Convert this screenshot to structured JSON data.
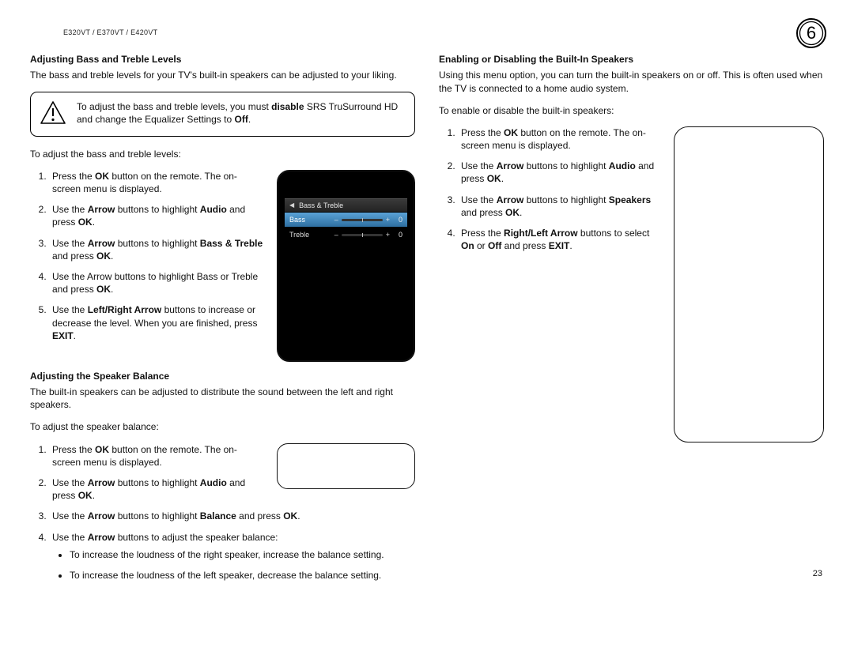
{
  "header": {
    "models": "E320VT / E370VT / E420VT",
    "chapter_number": "6"
  },
  "page_number": "23",
  "left": {
    "sec1": {
      "title": "Adjusting Bass and Treble Levels",
      "intro": "The bass and treble levels for your TV's built-in speakers can be adjusted to your liking.",
      "note_a": "To adjust the bass and treble levels, you must ",
      "note_b_bold": "disable",
      "note_c": " SRS TruSurround HD and change the Equalizer Settings to ",
      "note_d_bold": "Off",
      "note_e": ".",
      "lead": "To adjust the bass and treble levels:",
      "steps": {
        "s1a": "Press the ",
        "s1b": "OK",
        "s1c": " button on the remote. The on-screen menu is displayed.",
        "s2a": "Use the ",
        "s2b": "Arrow",
        "s2c": " buttons to highlight ",
        "s2d": "Audio",
        "s2e": " and press ",
        "s2f": "OK",
        "s2g": ".",
        "s3a": "Use the ",
        "s3b": "Arrow",
        "s3c": " buttons to highlight ",
        "s3d": "Bass & Treble",
        "s3e": " and press ",
        "s3f": "OK",
        "s3g": ".",
        "s4a": "Use the Arrow buttons to highlight Bass or Treble and press ",
        "s4b": "OK",
        "s4c": ".",
        "s5a": "Use the ",
        "s5b": "Left/Right Arrow",
        "s5c": " buttons to increase or decrease the level. When you are finished, press ",
        "s5d": "EXIT",
        "s5e": "."
      },
      "device_menu": {
        "title": "Bass & Treble",
        "rows": [
          {
            "label": "Bass",
            "value": "0",
            "selected": true
          },
          {
            "label": "Treble",
            "value": "0",
            "selected": false
          }
        ]
      }
    },
    "sec2": {
      "title": "Adjusting the Speaker Balance",
      "intro": "The built-in speakers can be adjusted to distribute the sound between the left and right speakers.",
      "lead": "To adjust the speaker balance:",
      "steps": {
        "s1a": "Press the ",
        "s1b": "OK",
        "s1c": " button on the remote. The on-screen menu is displayed.",
        "s2a": "Use the ",
        "s2b": "Arrow",
        "s2c": " buttons to highlight ",
        "s2d": "Audio",
        "s2e": " and press ",
        "s2f": "OK",
        "s2g": ".",
        "s3a": "Use the ",
        "s3b": "Arrow",
        "s3c": " buttons to highlight ",
        "s3d": "Balance",
        "s3e": " and press ",
        "s3f": "OK",
        "s3g": ".",
        "s4a": "Use the ",
        "s4b": "Arrow",
        "s4c": " buttons to adjust the speaker balance:",
        "b1": "To increase the loudness of the right speaker, increase the balance setting.",
        "b2": "To increase the loudness of the left speaker, decrease the balance setting."
      }
    }
  },
  "right": {
    "sec1": {
      "title": "Enabling or Disabling the Built-In Speakers",
      "intro": "Using this menu option, you can turn the built-in speakers on or off. This is often used when the TV is connected to a home audio system.",
      "lead": "To enable or disable the built-in speakers:",
      "steps": {
        "s1a": "Press the ",
        "s1b": "OK",
        "s1c": " button on the remote. The on-screen menu is displayed.",
        "s2a": "Use the ",
        "s2b": "Arrow",
        "s2c": " buttons to highlight ",
        "s2d": "Audio",
        "s2e": " and press ",
        "s2f": "OK",
        "s2g": ".",
        "s3a": "Use the ",
        "s3b": "Arrow",
        "s3c": " buttons to highlight ",
        "s3d": "Speakers",
        "s3e": " and press ",
        "s3f": "OK",
        "s3g": ".",
        "s4a": "Press the ",
        "s4b": "Right/Left Arrow",
        "s4c": " buttons to select ",
        "s4d": "On",
        "s4e": " or ",
        "s4f": "Off",
        "s4g": " and press ",
        "s4h": "EXIT",
        "s4i": "."
      }
    }
  }
}
